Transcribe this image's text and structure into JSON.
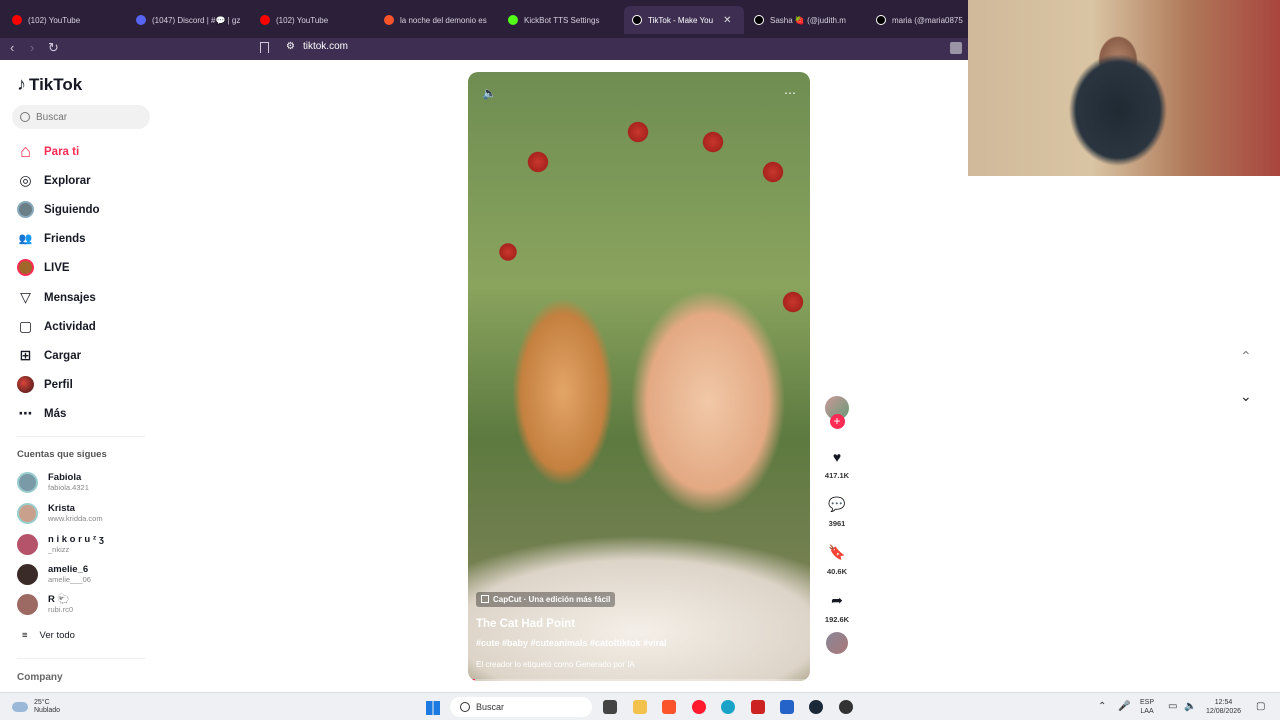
{
  "browser": {
    "tabs": [
      {
        "title": "(102) YouTube",
        "color": "#ff0000"
      },
      {
        "title": "(1047) Discord | #💬 | gz",
        "color": "#5865f2"
      },
      {
        "title": "(102) YouTube",
        "color": "#ff0000"
      },
      {
        "title": "la noche del demonio es",
        "color": "#fb542b"
      },
      {
        "title": "KickBot TTS Settings",
        "color": "#53fc18"
      },
      {
        "title": "TikTok - Make You",
        "color": "#000000"
      },
      {
        "title": "Sasha 🍓 (@judith.m",
        "color": "#000000"
      },
      {
        "title": "maria (@maria0875",
        "color": "#000000"
      }
    ],
    "url": "tiktok.com",
    "close_glyph": "✕"
  },
  "sidebar": {
    "logo": "TikTok",
    "search_placeholder": "Buscar",
    "nav": [
      {
        "label": "Para ti",
        "icon": "home-icon",
        "glyph": "⌂"
      },
      {
        "label": "Explorar",
        "icon": "compass-icon",
        "glyph": "◎"
      },
      {
        "label": "Siguiendo",
        "icon": "avatar"
      },
      {
        "label": "Friends",
        "icon": "friends-icon",
        "glyph": "👥"
      },
      {
        "label": "LIVE",
        "icon": "avatar"
      },
      {
        "label": "Mensajes",
        "icon": "send-icon",
        "glyph": "▽"
      },
      {
        "label": "Actividad",
        "icon": "activity-icon",
        "glyph": "▢"
      },
      {
        "label": "Cargar",
        "icon": "upload-icon",
        "glyph": "⊞"
      },
      {
        "label": "Perfil",
        "icon": "avatar"
      },
      {
        "label": "Más",
        "icon": "more-icon",
        "glyph": "⋯"
      }
    ],
    "following_title": "Cuentas que sigues",
    "following": [
      {
        "name": "Fabiola",
        "sub": "fabiola.4321",
        "color": "#7a9aa8"
      },
      {
        "name": "Krista",
        "sub": "www.kridda.com",
        "color": "#c9a08c"
      },
      {
        "name": "n i k o r u ᶻ ʒ",
        "sub": "_nkizz",
        "color": "#b5536b"
      },
      {
        "name": "amelie_6",
        "sub": "amelie___06",
        "color": "#3a2a28"
      },
      {
        "name": "R 🐑",
        "sub": "rubi.rc0",
        "color": "#9c6a62"
      }
    ],
    "see_all": "Ver todo",
    "company": "Company"
  },
  "video": {
    "badge": "CapCut · Una edición más fácil",
    "title": "The Cat Had Point",
    "tags": "#cute #baby #cuteanimals #catoftiktok #viral",
    "ai_label": "El creador lo etiquetó como Generado por IA",
    "progress": 0.02
  },
  "actions": {
    "likes": "417.1K",
    "comments": "3961",
    "saves": "40.6K",
    "shares": "192.6K"
  },
  "taskbar": {
    "temp": "25°C",
    "weather": "Nublado",
    "search": "Buscar",
    "lang1": "ESP",
    "lang2": "LAA",
    "time": "12:54",
    "date": "12/08/2026"
  }
}
